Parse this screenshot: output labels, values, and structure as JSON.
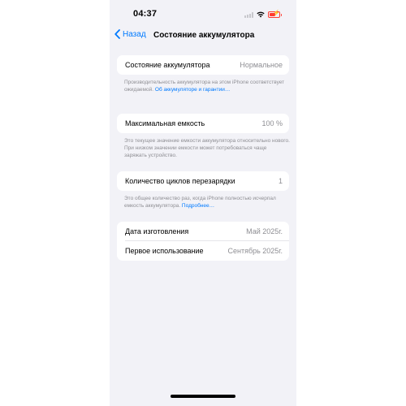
{
  "status_bar": {
    "time": "04:37",
    "battery_color": "#ff3b30"
  },
  "nav": {
    "back_label": "Назад",
    "title": "Состояние аккумулятора",
    "accent": "#007aff"
  },
  "battery_health": {
    "label": "Состояние аккумулятора",
    "value": "Нормальное",
    "footer_text": "Производительность аккумулятора на этом iPhone соответствует ожидаемой.",
    "footer_link": "Об аккумуляторе и гарантии…"
  },
  "max_capacity": {
    "label": "Максимальная емкость",
    "value": "100 %",
    "footer_text": "Это текущее значение емкости аккумулятора относительно нового. При низком значении емкости может потребоваться чаще заряжать устройство."
  },
  "cycle_count": {
    "label": "Количество циклов перезарядки",
    "value": "1",
    "footer_text": "Это общее количество раз, когда iPhone полностью исчерпал емкость аккумулятора.",
    "footer_link": "Подробнее…"
  },
  "dates": {
    "manufacture_label": "Дата изготовления",
    "manufacture_value": "Май 2025г.",
    "first_use_label": "Первое использование",
    "first_use_value": "Сентябрь 2025г."
  }
}
